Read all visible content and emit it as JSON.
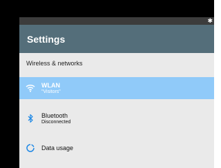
{
  "app_bar": {
    "title": "Settings"
  },
  "section": {
    "header": "Wireless & networks"
  },
  "items": [
    {
      "title": "WLAN",
      "subtitle": "\"Visitors\"",
      "icon": "wifi-icon",
      "selected": true
    },
    {
      "title": "Bluetooth",
      "subtitle": "Disconnected",
      "icon": "bluetooth-icon",
      "selected": false
    },
    {
      "title": "Data usage",
      "subtitle": "",
      "icon": "data-usage-icon",
      "selected": false
    }
  ],
  "status_bar": {
    "icon": "bluetooth-icon"
  },
  "colors": {
    "app_bar": "#546e7a",
    "selected_row": "#90caf9",
    "list_background": "#eaeaea",
    "icon_blue": "#1e88e5"
  }
}
